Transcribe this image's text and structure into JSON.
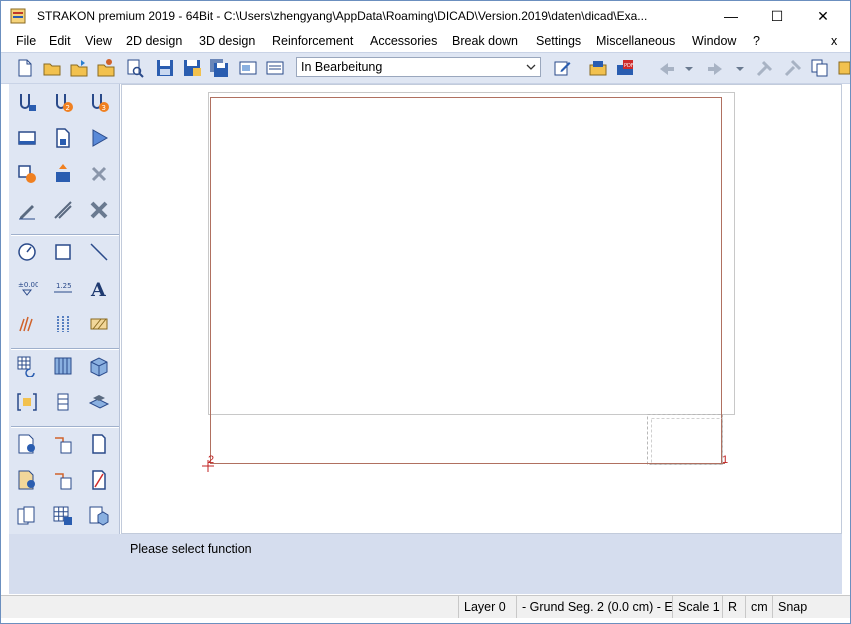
{
  "window": {
    "title": "STRAKON premium 2019 - 64Bit  - C:\\Users\\zhengyang\\AppData\\Roaming\\DICAD\\Version.2019\\daten\\dicad\\Exa...",
    "minimize_glyph": "—",
    "maximize_glyph": "☐",
    "close_glyph": "✕"
  },
  "menu": {
    "items": [
      "File",
      "Edit",
      "View",
      "2D design",
      "3D design",
      "Reinforcement",
      "Accessories",
      "Break down",
      "Settings",
      "Miscellaneous",
      "Window",
      "?"
    ],
    "close_glyph": "x"
  },
  "toolbar": {
    "status_select": {
      "value": "In Bearbeitung"
    },
    "icons": [
      "new-file-icon",
      "open-folder-icon",
      "open-folder-arrow-icon",
      "open-folder-user-icon",
      "print-preview-icon",
      "save-icon",
      "save-as-icon",
      "save-all-icon",
      "layout-icon",
      "plan-icon",
      "edit-note-icon",
      "export-icon",
      "pdf-export-icon",
      "undo-arrow-icon",
      "redo-arrow-icon",
      "tools-icon",
      "tools-disabled-icon",
      "copy-icon"
    ]
  },
  "palette": {
    "icons": [
      "axis-tool-icon",
      "axis-tool-2-icon",
      "axis-tool-3-icon",
      "window-frame-icon",
      "document-icon",
      "play-icon",
      "transform-icon",
      "move-icon",
      "delete-node-icon",
      "pencil-icon",
      "dimension-adjust-icon",
      "delete-x-icon",
      "measure-dial-icon",
      "rectangle-icon",
      "line-icon",
      "elevation-mark-icon",
      "dimension-icon",
      "text-icon",
      "hatch-lines-icon",
      "grid-lines-icon",
      "hatch-fill-icon",
      "grid-rotate-icon",
      "solid-grid-icon",
      "cube-grid-icon",
      "bracket-grid-icon",
      "small-grid-icon",
      "object-stack-icon",
      "sheet-settings-icon",
      "beam-icon",
      "page-icon",
      "sheet-settings-2-icon",
      "beam-2-icon",
      "page-slash-icon",
      "multi-page-icon",
      "grid-table-icon",
      "cube-table-icon"
    ]
  },
  "canvas": {
    "label_left": "2",
    "label_right": "1"
  },
  "command": {
    "prompt": "Please select function"
  },
  "statusbar": {
    "layer": "Layer 0",
    "segment": "- Grund Seg. 2 (0.0 cm) - E",
    "scale": "Scale 1",
    "mode": "R",
    "unit": "cm",
    "snap": "Snap"
  },
  "colors": {
    "accent": "#1f5fbf",
    "drawing_line": "#b07060",
    "toolbar_bg": "#dfe6f3"
  }
}
